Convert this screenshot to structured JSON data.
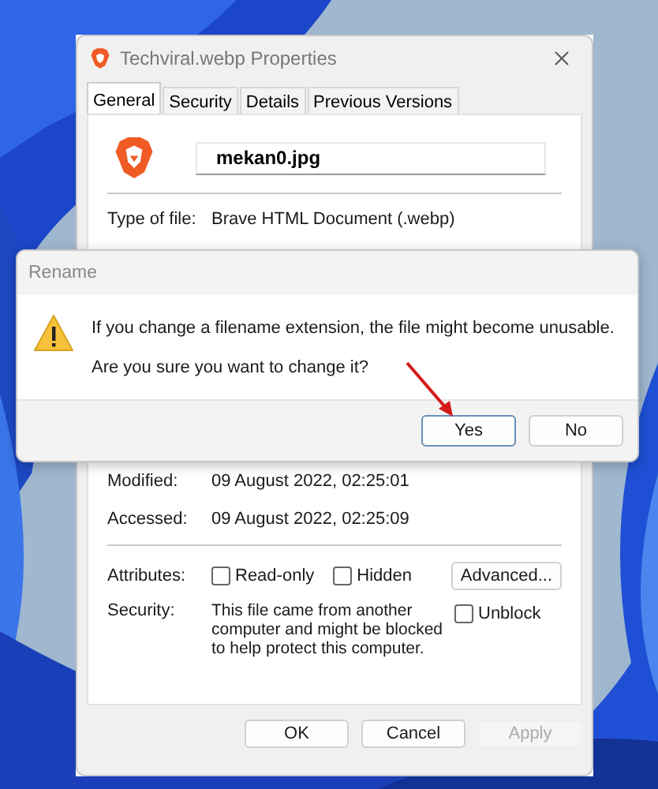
{
  "properties_window": {
    "title": "Techviral.webp Properties",
    "tabs": [
      {
        "label": "General",
        "selected": true
      },
      {
        "label": "Security",
        "selected": false
      },
      {
        "label": "Details",
        "selected": false
      },
      {
        "label": "Previous Versions",
        "selected": false
      }
    ],
    "file_name": "mekan0.jpg",
    "type_row": {
      "label": "Type of file:",
      "value": "Brave HTML Document (.webp)"
    },
    "date_rows": [
      {
        "label": "Modified:",
        "value": "09 August 2022, 02:25:01"
      },
      {
        "label": "Accessed:",
        "value": "09 August 2022, 02:25:09"
      }
    ],
    "attributes": {
      "label": "Attributes:",
      "checkboxes": [
        {
          "label": "Read-only",
          "checked": false
        },
        {
          "label": "Hidden",
          "checked": false
        }
      ],
      "button": "Advanced..."
    },
    "security": {
      "label": "Security:",
      "text": "This file came from another computer and might be blocked to help protect this computer.",
      "checkbox": {
        "label": "Unblock",
        "checked": false
      }
    },
    "buttons": [
      {
        "label": "OK",
        "disabled": false
      },
      {
        "label": "Cancel",
        "disabled": false
      },
      {
        "label": "Apply",
        "disabled": true
      }
    ]
  },
  "rename_dialog": {
    "title": "Rename",
    "message": "If you change a filename extension, the file might become unusable.",
    "question": "Are you sure you want to change it?",
    "buttons": [
      {
        "label": "Yes",
        "default": true
      },
      {
        "label": "No",
        "default": false
      }
    ]
  }
}
